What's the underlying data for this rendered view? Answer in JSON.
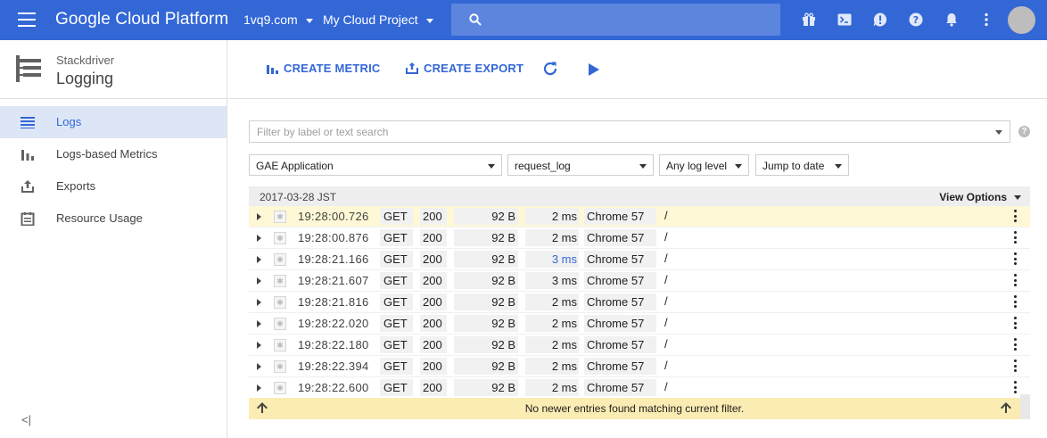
{
  "topbar": {
    "brand": "Google Cloud Platform",
    "account": "1vq9.com",
    "project": "My Cloud Project",
    "icons": [
      "gift-icon",
      "terminal-icon",
      "alert-icon",
      "help-icon",
      "notifications-icon",
      "more-vert-icon"
    ]
  },
  "nav": {
    "product_sub": "Stackdriver",
    "product_title": "Logging",
    "items": [
      {
        "label": "Logs",
        "icon": "list-icon",
        "active": true
      },
      {
        "label": "Logs-based Metrics",
        "icon": "bar-chart-icon",
        "active": false
      },
      {
        "label": "Exports",
        "icon": "export-icon",
        "active": false
      },
      {
        "label": "Resource Usage",
        "icon": "resource-icon",
        "active": false
      }
    ],
    "collapse": "<|"
  },
  "actions": {
    "create_metric": "CREATE METRIC",
    "create_export": "CREATE EXPORT"
  },
  "filter": {
    "placeholder": "Filter by label or text search",
    "resource": "GAE Application",
    "log": "request_log",
    "level": "Any log level",
    "jump": "Jump to date"
  },
  "log": {
    "date": "2017-03-28 JST",
    "view_options": "View Options",
    "rows": [
      {
        "ts": "19:28:00.726",
        "method": "GET",
        "status": "200",
        "size": "92 B",
        "latency": "2 ms",
        "ua": "Chrome 57",
        "path": "/"
      },
      {
        "ts": "19:28:00.876",
        "method": "GET",
        "status": "200",
        "size": "92 B",
        "latency": "2 ms",
        "ua": "Chrome 57",
        "path": "/"
      },
      {
        "ts": "19:28:21.166",
        "method": "GET",
        "status": "200",
        "size": "92 B",
        "latency": "3 ms",
        "ua": "Chrome 57",
        "path": "/"
      },
      {
        "ts": "19:28:21.607",
        "method": "GET",
        "status": "200",
        "size": "92 B",
        "latency": "3 ms",
        "ua": "Chrome 57",
        "path": "/"
      },
      {
        "ts": "19:28:21.816",
        "method": "GET",
        "status": "200",
        "size": "92 B",
        "latency": "2 ms",
        "ua": "Chrome 57",
        "path": "/"
      },
      {
        "ts": "19:28:22.020",
        "method": "GET",
        "status": "200",
        "size": "92 B",
        "latency": "2 ms",
        "ua": "Chrome 57",
        "path": "/"
      },
      {
        "ts": "19:28:22.180",
        "method": "GET",
        "status": "200",
        "size": "92 B",
        "latency": "2 ms",
        "ua": "Chrome 57",
        "path": "/"
      },
      {
        "ts": "19:28:22.394",
        "method": "GET",
        "status": "200",
        "size": "92 B",
        "latency": "2 ms",
        "ua": "Chrome 57",
        "path": "/"
      },
      {
        "ts": "19:28:22.600",
        "method": "GET",
        "status": "200",
        "size": "92 B",
        "latency": "2 ms",
        "ua": "Chrome 57",
        "path": "/"
      }
    ],
    "footer_message": "No newer entries found matching current filter."
  },
  "colors": {
    "brand_blue": "#3367d6",
    "nav_active_bg": "#dde6f7",
    "highlight_row": "#fff8d6",
    "footer_bg": "#fbecb3"
  }
}
